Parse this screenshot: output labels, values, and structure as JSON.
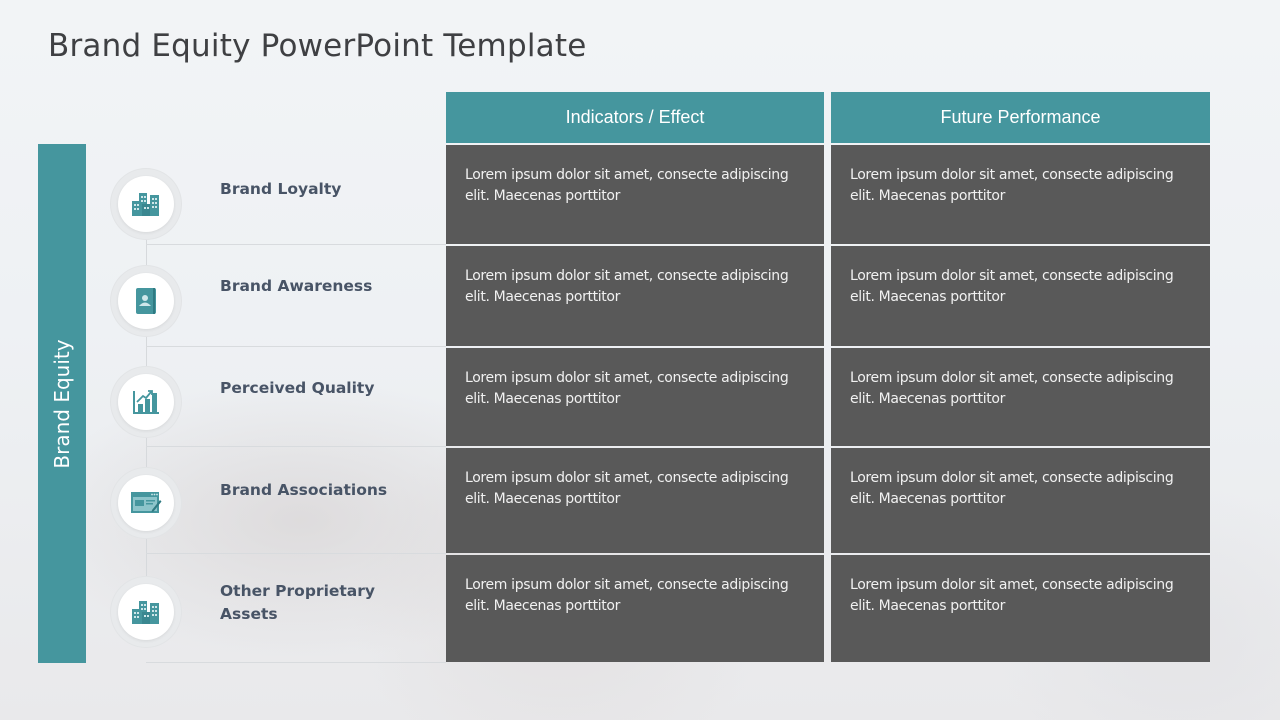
{
  "slide": {
    "title": "Brand Equity PowerPoint Template",
    "side_label": "Brand Equity",
    "columns": [
      "Indicators / Effect",
      "Future Performance"
    ],
    "colors": {
      "accent_teal": "#45969e",
      "cell_gray": "#595959",
      "title_text": "#3f4043",
      "label_text": "#485466"
    },
    "rows": [
      {
        "label": "Brand Loyalty",
        "icon": "buildings-icon",
        "cells": [
          "Lorem ipsum dolor sit amet, consecte adipiscing elit. Maecenas porttitor",
          "Lorem ipsum dolor sit amet, consecte adipiscing elit. Maecenas porttitor"
        ]
      },
      {
        "label": "Brand Awareness",
        "icon": "contact-book-icon",
        "cells": [
          "Lorem ipsum dolor sit amet, consecte adipiscing elit. Maecenas porttitor",
          "Lorem ipsum dolor sit amet, consecte adipiscing elit. Maecenas porttitor"
        ]
      },
      {
        "label": "Perceived Quality",
        "icon": "growth-chart-icon",
        "cells": [
          "Lorem ipsum dolor sit amet, consecte adipiscing elit. Maecenas porttitor",
          "Lorem ipsum dolor sit amet, consecte adipiscing elit. Maecenas porttitor"
        ]
      },
      {
        "label": "Brand Associations",
        "icon": "browser-edit-icon",
        "cells": [
          "Lorem ipsum dolor sit amet, consecte adipiscing elit. Maecenas porttitor",
          "Lorem ipsum dolor sit amet, consecte adipiscing elit. Maecenas porttitor"
        ]
      },
      {
        "label": "Other Proprietary Assets",
        "icon": "buildings-icon",
        "cells": [
          "Lorem ipsum dolor sit amet, consecte adipiscing elit. Maecenas porttitor",
          "Lorem ipsum dolor sit amet, consecte adipiscing elit. Maecenas porttitor"
        ]
      }
    ]
  }
}
